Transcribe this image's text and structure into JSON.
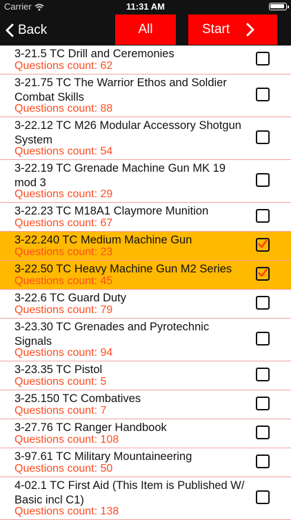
{
  "status_bar": {
    "carrier": "Carrier",
    "time": "11:31 AM"
  },
  "nav": {
    "back_label": "Back",
    "all_label": "All",
    "start_label": "Start",
    "accent_color": "#ff0000",
    "bar_color": "#121212"
  },
  "list": {
    "selected_color": "#ffb900",
    "count_color": "#ff4b1f",
    "items": [
      {
        "title": "3-21.5 TC Drill and Ceremonies",
        "count": "Questions count: 62",
        "checked": false
      },
      {
        "title": "3-21.75 TC The Warrior Ethos and Soldier Combat Skills",
        "count": "Questions count: 88",
        "checked": false
      },
      {
        "title": "3-22.12 TC M26 Modular Accessory Shotgun System",
        "count": "Questions count: 54",
        "checked": false
      },
      {
        "title": "3-22.19 TC Grenade Machine Gun MK 19 mod 3",
        "count": "Questions count: 29",
        "checked": false
      },
      {
        "title": "3-22.23 TC M18A1 Claymore Munition",
        "count": "Questions count: 67",
        "checked": false
      },
      {
        "title": "3-22.240 TC Medium Machine Gun",
        "count": "Questions count: 23",
        "checked": true
      },
      {
        "title": "3-22.50 TC Heavy Machine Gun M2 Series",
        "count": "Questions count: 45",
        "checked": true
      },
      {
        "title": "3-22.6 TC Guard Duty",
        "count": "Questions count: 79",
        "checked": false
      },
      {
        "title": "3-23.30 TC Grenades and Pyrotechnic Signals",
        "count": "Questions count: 94",
        "checked": false
      },
      {
        "title": "3-23.35 TC Pistol",
        "count": "Questions count: 5",
        "checked": false
      },
      {
        "title": "3-25.150 TC Combatives",
        "count": "Questions count: 7",
        "checked": false
      },
      {
        "title": "3-27.76 TC Ranger Handbook",
        "count": "Questions count: 108",
        "checked": false
      },
      {
        "title": "3-97.61 TC Military Mountaineering",
        "count": "Questions count: 50",
        "checked": false
      },
      {
        "title": "4-02.1 TC First Aid (This Item is Published W/ Basic incl C1)",
        "count": "Questions count: 138",
        "checked": false
      }
    ]
  }
}
